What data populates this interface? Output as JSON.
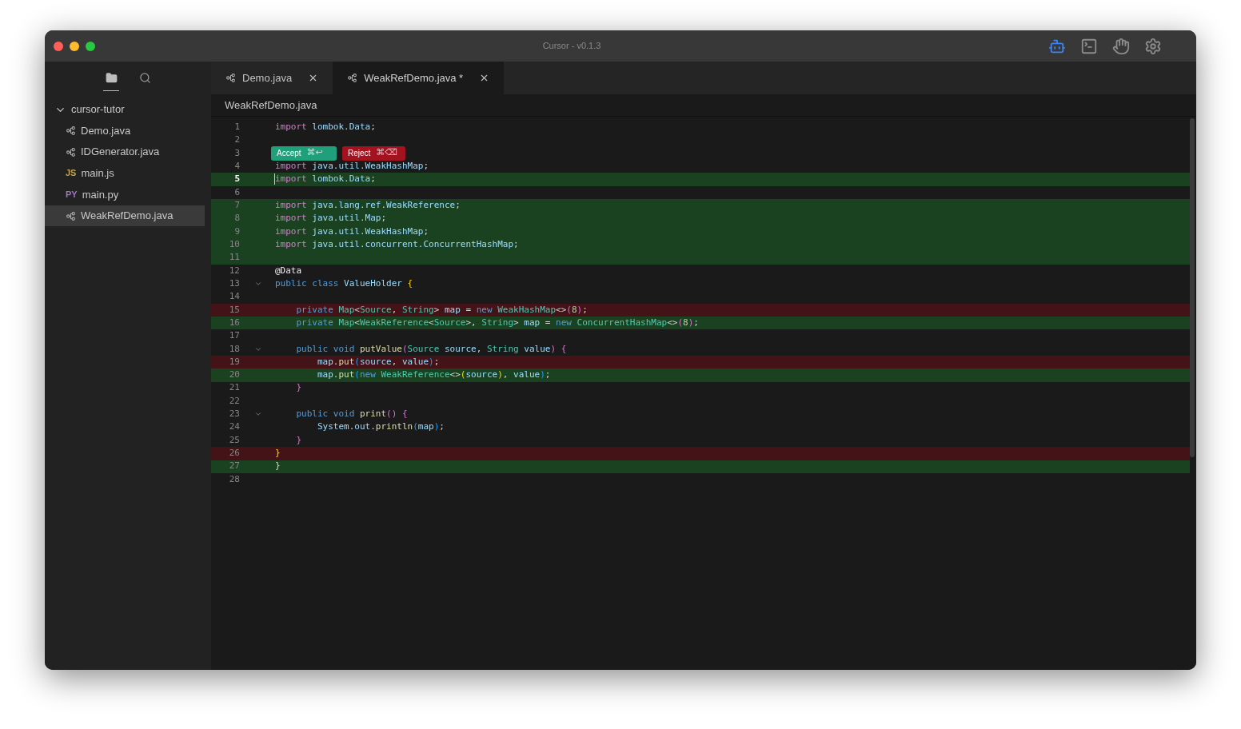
{
  "window": {
    "title": "Cursor - v0.1.3"
  },
  "toolbar_icons": [
    {
      "kind": "robot",
      "selected": true
    },
    {
      "kind": "terminal",
      "selected": false
    },
    {
      "kind": "hand",
      "selected": false
    },
    {
      "kind": "gear",
      "selected": false
    }
  ],
  "sidebar": {
    "views": [
      {
        "kind": "folder",
        "selected": true
      },
      {
        "kind": "search",
        "selected": false
      }
    ],
    "tree": [
      {
        "label": "cursor-tutor",
        "expanded": true,
        "children": [
          {
            "label": "Demo.java",
            "kind": "java",
            "selected": false
          },
          {
            "label": "IDGenerator.java",
            "kind": "java",
            "selected": false
          },
          {
            "label": "main.js",
            "kind": "badge",
            "badge": "JS",
            "color": "#c7a24a",
            "selected": false
          },
          {
            "label": "main.py",
            "kind": "badge",
            "badge": "PY",
            "color": "#a074c4",
            "selected": false
          },
          {
            "label": "WeakRefDemo.java",
            "kind": "java",
            "selected": true
          }
        ]
      }
    ]
  },
  "tabs": [
    {
      "label": "Demo.java",
      "selected": false
    },
    {
      "label": "WeakRefDemo.java *",
      "selected": true
    }
  ],
  "breadcrumb": "WeakRefDemo.java",
  "diff_actions": [
    {
      "kind": "accept",
      "label": "Accept",
      "shortcut": "⌘↩"
    },
    {
      "kind": "reject",
      "label": "Reject",
      "shortcut": "⌘⌫"
    }
  ],
  "lines": [
    {
      "number": "1",
      "kind": "unchanged",
      "tokens": [
        {
          "text": "import",
          "kind": "kw"
        },
        {
          "text": " lombok.Data",
          "kind": "id"
        },
        {
          "text": ";",
          "kind": "plain"
        }
      ]
    },
    {
      "number": "2",
      "kind": "unchanged"
    },
    {
      "number": "3",
      "kind": "unchanged"
    },
    {
      "number": "4",
      "kind": "unchanged",
      "tokens": [
        {
          "text": "import",
          "kind": "kw"
        },
        {
          "text": " java.util.WeakHashMap",
          "kind": "id"
        },
        {
          "text": ";",
          "kind": "plain"
        }
      ]
    },
    {
      "number": "5",
      "kind": "added",
      "current": true,
      "tokens": [
        {
          "text": "import",
          "kind": "kw"
        },
        {
          "text": " lombok.Data",
          "kind": "id"
        },
        {
          "text": ";",
          "kind": "plain"
        }
      ]
    },
    {
      "number": "6",
      "kind": "unchanged"
    },
    {
      "number": "7",
      "kind": "added",
      "tokens": [
        {
          "text": "import",
          "kind": "kw"
        },
        {
          "text": " java.lang.ref.WeakReference",
          "kind": "id"
        },
        {
          "text": ";",
          "kind": "plain"
        }
      ]
    },
    {
      "number": "8",
      "kind": "added",
      "tokens": [
        {
          "text": "import",
          "kind": "kw"
        },
        {
          "text": " java.util.Map",
          "kind": "id"
        },
        {
          "text": ";",
          "kind": "plain"
        }
      ]
    },
    {
      "number": "9",
      "kind": "added",
      "tokens": [
        {
          "text": "import",
          "kind": "kw"
        },
        {
          "text": " java.util.WeakHashMap",
          "kind": "id"
        },
        {
          "text": ";",
          "kind": "plain"
        }
      ]
    },
    {
      "number": "10",
      "kind": "added",
      "tokens": [
        {
          "text": "import",
          "kind": "kw"
        },
        {
          "text": " java.util.concurrent.ConcurrentHashMap",
          "kind": "id"
        },
        {
          "text": ";",
          "kind": "plain"
        }
      ]
    },
    {
      "number": "11",
      "kind": "added"
    },
    {
      "number": "12",
      "kind": "unchanged",
      "tokens": [
        {
          "text": "@Data",
          "kind": "annotation"
        }
      ]
    },
    {
      "number": "13",
      "kind": "unchanged",
      "foldable": true,
      "tokens": [
        {
          "text": "public",
          "kind": "st"
        },
        {
          "text": " class",
          "kind": "st"
        },
        {
          "text": " ValueHolder",
          "kind": "id"
        },
        {
          "text": " {",
          "kind": "brace"
        }
      ]
    },
    {
      "number": "14",
      "kind": "unchanged"
    },
    {
      "number": "15",
      "kind": "removed",
      "tokens": [
        {
          "text": "    private",
          "kind": "st"
        },
        {
          "text": " Map",
          "kind": "type"
        },
        {
          "text": "<",
          "kind": "plain"
        },
        {
          "text": "Source",
          "kind": "type"
        },
        {
          "text": ", ",
          "kind": "plain"
        },
        {
          "text": "String",
          "kind": "type"
        },
        {
          "text": "> ",
          "kind": "plain"
        },
        {
          "text": "map",
          "kind": "id"
        },
        {
          "text": " = ",
          "kind": "plain"
        },
        {
          "text": "new",
          "kind": "st"
        },
        {
          "text": " WeakHashMap",
          "kind": "type"
        },
        {
          "text": "<>",
          "kind": "plain"
        },
        {
          "text": "(",
          "kind": "paren"
        },
        {
          "text": "8",
          "kind": "num"
        },
        {
          "text": ")",
          "kind": "paren"
        },
        {
          "text": ";",
          "kind": "plain"
        }
      ]
    },
    {
      "number": "16",
      "kind": "added",
      "tokens": [
        {
          "text": "    private",
          "kind": "st"
        },
        {
          "text": " Map",
          "kind": "type"
        },
        {
          "text": "<",
          "kind": "plain"
        },
        {
          "text": "WeakReference",
          "kind": "type"
        },
        {
          "text": "<",
          "kind": "plain"
        },
        {
          "text": "Source",
          "kind": "type"
        },
        {
          "text": ">, ",
          "kind": "plain"
        },
        {
          "text": "String",
          "kind": "type"
        },
        {
          "text": "> ",
          "kind": "plain"
        },
        {
          "text": "map",
          "kind": "id"
        },
        {
          "text": " = ",
          "kind": "plain"
        },
        {
          "text": "new",
          "kind": "st"
        },
        {
          "text": " ConcurrentHashMap",
          "kind": "type"
        },
        {
          "text": "<>",
          "kind": "plain"
        },
        {
          "text": "(",
          "kind": "paren"
        },
        {
          "text": "8",
          "kind": "num"
        },
        {
          "text": ")",
          "kind": "paren"
        },
        {
          "text": ";",
          "kind": "plain"
        }
      ]
    },
    {
      "number": "17",
      "kind": "unchanged"
    },
    {
      "number": "18",
      "kind": "unchanged",
      "foldable": true,
      "tokens": [
        {
          "text": "    public",
          "kind": "st"
        },
        {
          "text": " void",
          "kind": "st"
        },
        {
          "text": " putValue",
          "kind": "fn"
        },
        {
          "text": "(",
          "kind": "paren"
        },
        {
          "text": "Source",
          "kind": "type"
        },
        {
          "text": " source",
          "kind": "id"
        },
        {
          "text": ", ",
          "kind": "plain"
        },
        {
          "text": "String",
          "kind": "type"
        },
        {
          "text": " value",
          "kind": "id"
        },
        {
          "text": ")",
          "kind": "paren"
        },
        {
          "text": " {",
          "kind": "paren"
        }
      ]
    },
    {
      "number": "19",
      "kind": "removed",
      "tokens": [
        {
          "text": "        map",
          "kind": "id"
        },
        {
          "text": ".",
          "kind": "plain"
        },
        {
          "text": "put",
          "kind": "fn"
        },
        {
          "text": "(",
          "kind": "bracket"
        },
        {
          "text": "source",
          "kind": "id"
        },
        {
          "text": ", ",
          "kind": "plain"
        },
        {
          "text": "value",
          "kind": "id"
        },
        {
          "text": ")",
          "kind": "bracket"
        },
        {
          "text": ";",
          "kind": "plain"
        }
      ]
    },
    {
      "number": "20",
      "kind": "added",
      "tokens": [
        {
          "text": "        map",
          "kind": "id"
        },
        {
          "text": ".",
          "kind": "plain"
        },
        {
          "text": "put",
          "kind": "fn"
        },
        {
          "text": "(",
          "kind": "bracket"
        },
        {
          "text": "new",
          "kind": "st"
        },
        {
          "text": " WeakReference",
          "kind": "type"
        },
        {
          "text": "<>",
          "kind": "plain"
        },
        {
          "text": "(",
          "kind": "brace"
        },
        {
          "text": "source",
          "kind": "id"
        },
        {
          "text": ")",
          "kind": "brace"
        },
        {
          "text": ", ",
          "kind": "plain"
        },
        {
          "text": "value",
          "kind": "id"
        },
        {
          "text": ")",
          "kind": "bracket"
        },
        {
          "text": ";",
          "kind": "plain"
        }
      ]
    },
    {
      "number": "21",
      "kind": "unchanged",
      "tokens": [
        {
          "text": "    }",
          "kind": "paren"
        }
      ]
    },
    {
      "number": "22",
      "kind": "unchanged"
    },
    {
      "number": "23",
      "kind": "unchanged",
      "foldable": true,
      "tokens": [
        {
          "text": "    public",
          "kind": "st"
        },
        {
          "text": " void",
          "kind": "st"
        },
        {
          "text": " print",
          "kind": "fn"
        },
        {
          "text": "()",
          "kind": "paren"
        },
        {
          "text": " {",
          "kind": "paren"
        }
      ]
    },
    {
      "number": "24",
      "kind": "unchanged",
      "tokens": [
        {
          "text": "        System",
          "kind": "id"
        },
        {
          "text": ".",
          "kind": "plain"
        },
        {
          "text": "out",
          "kind": "id"
        },
        {
          "text": ".",
          "kind": "plain"
        },
        {
          "text": "println",
          "kind": "fn"
        },
        {
          "text": "(",
          "kind": "bracket"
        },
        {
          "text": "map",
          "kind": "id"
        },
        {
          "text": ")",
          "kind": "bracket"
        },
        {
          "text": ";",
          "kind": "plain"
        }
      ]
    },
    {
      "number": "25",
      "kind": "unchanged",
      "tokens": [
        {
          "text": "    }",
          "kind": "paren"
        }
      ]
    },
    {
      "number": "26",
      "kind": "removed",
      "tokens": [
        {
          "text": "}",
          "kind": "brace"
        }
      ]
    },
    {
      "number": "27",
      "kind": "added",
      "tokens": [
        {
          "text": "}",
          "kind": "plain"
        }
      ]
    },
    {
      "number": "28",
      "kind": "unchanged"
    }
  ]
}
